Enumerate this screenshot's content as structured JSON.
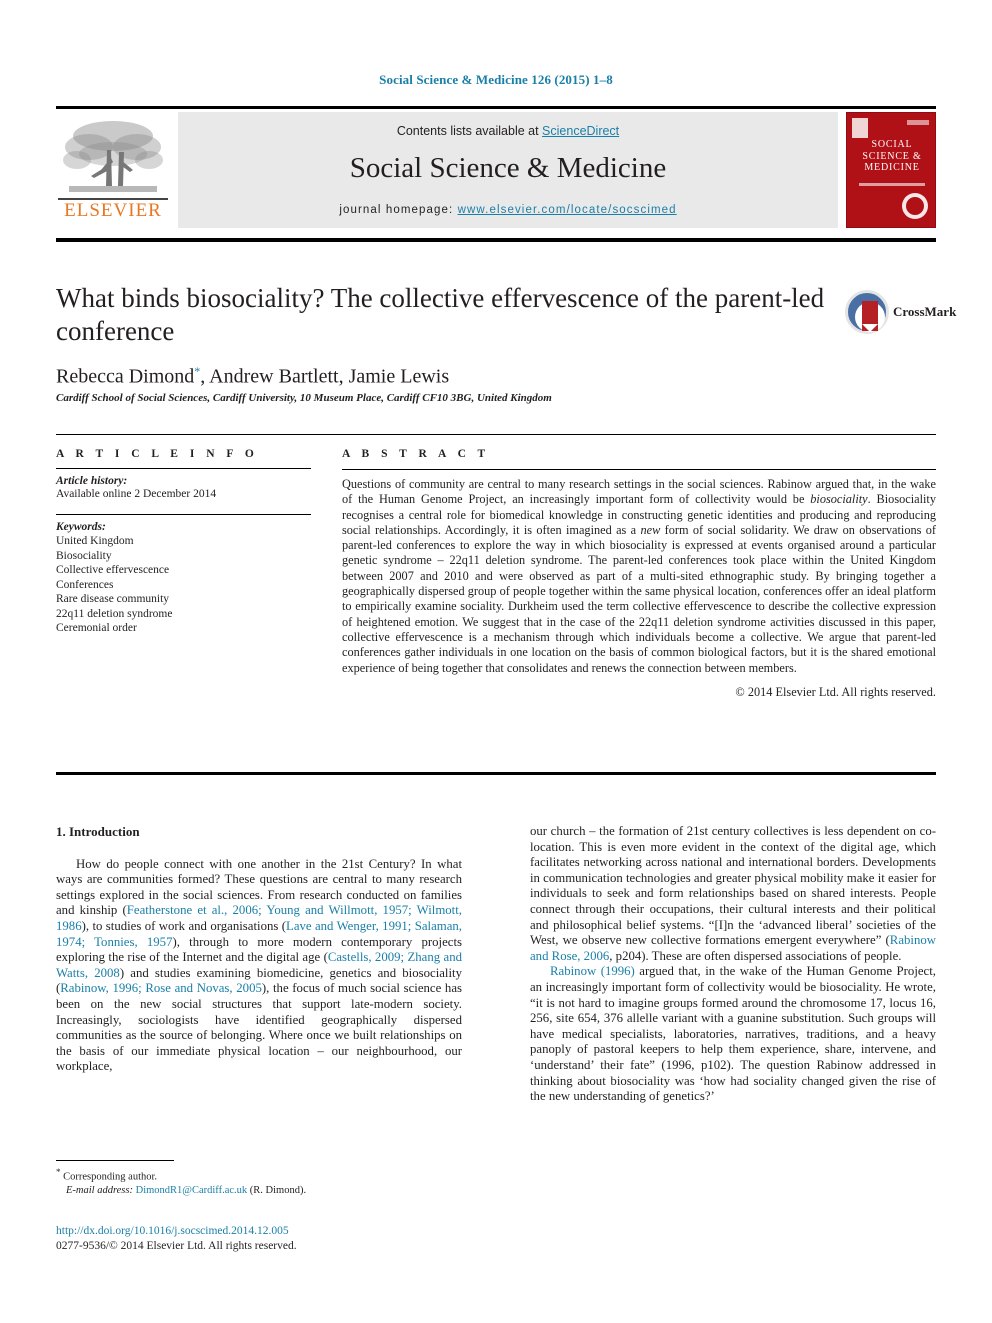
{
  "running_head": "Social Science & Medicine 126 (2015) 1–8",
  "masthead": {
    "contents_prefix": "Contents lists available at ",
    "sciencedirect": "ScienceDirect",
    "journal_name": "Social Science & Medicine",
    "homepage_prefix": "journal homepage: ",
    "homepage_url": "www.elsevier.com/locate/socscimed",
    "publisher_logo_text": "ELSEVIER",
    "cover_title": "SOCIAL SCIENCE & MEDICINE",
    "accent_link_color": "#1a7fa8",
    "publisher_orange": "#E87722",
    "cover_red": "#b01117"
  },
  "crossmark": {
    "label": "CrossMark",
    "badge_color": "#4a6fa5"
  },
  "article": {
    "title": "What binds biosociality? The collective effervescence of the parent-led conference",
    "authors": "Rebecca Dimond",
    "authors_rest": ", Andrew Bartlett, Jamie Lewis",
    "corresponding_marker": "*",
    "affiliation": "Cardiff School of Social Sciences, Cardiff University, 10 Museum Place, Cardiff CF10 3BG, United Kingdom"
  },
  "article_info": {
    "heading": "A R T I C L E   I N F O",
    "history_label": "Article history:",
    "history_value": "Available online 2 December 2014",
    "keywords_label": "Keywords:",
    "keywords": [
      "United Kingdom",
      "Biosociality",
      "Collective effervescence",
      "Conferences",
      "Rare disease community",
      "22q11 deletion syndrome",
      "Ceremonial order"
    ]
  },
  "abstract": {
    "heading": "A B S T R A C T",
    "part1": "Questions of community are central to many research settings in the social sciences. Rabinow argued that, in the wake of the Human Genome Project, an increasingly important form of collectivity would be ",
    "italic1": "biosociality",
    "part2": ". Biosociality recognises a central role for biomedical knowledge in constructing genetic identities and producing and reproducing social relationships. Accordingly, it is often imagined as a ",
    "italic2": "new",
    "part3": " form of social solidarity. We draw on observations of parent-led conferences to explore the way in which biosociality is expressed at events organised around a particular genetic syndrome – 22q11 deletion syndrome. The parent-led conferences took place within the United Kingdom between 2007 and 2010 and were observed as part of a multi-sited ethnographic study. By bringing together a geographically dispersed group of people together within the same physical location, conferences offer an ideal platform to empirically examine sociality. Durkheim used the term collective effervescence to describe the collective expression of heightened emotion. We suggest that in the case of the 22q11 deletion syndrome activities discussed in this paper, collective effervescence is a mechanism through which individuals become a collective. We argue that parent-led conferences gather individuals in one location on the basis of common biological factors, but it is the shared emotional experience of being together that consolidates and renews the connection between members.",
    "copyright": "© 2014 Elsevier Ltd. All rights reserved."
  },
  "body": {
    "section_number_title": "1. Introduction",
    "left_p1_a": "How do people connect with one another in the 21st Century? In what ways are communities formed? These questions are central to many research settings explored in the social sciences. From research conducted on families and kinship (",
    "left_ref1": "Featherstone et al., 2006; Young and Willmott, 1957; Wilmott, 1986",
    "left_p1_b": "), to studies of work and organisations (",
    "left_ref2": "Lave and Wenger, 1991; Salaman, 1974; Tonnies, 1957",
    "left_p1_c": "), through to more modern contemporary projects exploring the rise of the Internet and the digital age (",
    "left_ref3": "Castells, 2009; Zhang and Watts, 2008",
    "left_p1_d": ") and studies examining biomedicine, genetics and biosociality (",
    "left_ref4": "Rabinow, 1996; Rose and Novas, 2005",
    "left_p1_e": "), the focus of much social science has been on the new social structures that support late-modern society. Increasingly, sociologists have identified geographically dispersed communities as the source of belonging. Where once we built relationships on the basis of our immediate physical location – our neighbourhood, our workplace,",
    "right_p1_a": "our church – the formation of 21st century collectives is less dependent on co-location. This is even more evident in the context of the digital age, which facilitates networking across national and international borders. Developments in communication technologies and greater physical mobility make it easier for individuals to seek and form relationships based on shared interests. People connect through their occupations, their cultural interests and their political and philosophical belief systems. “[I]n the ‘advanced liberal’ societies of the West, we observe new collective formations emergent everywhere” (",
    "right_ref1": "Rabinow and Rose, 2006",
    "right_p1_b": ", p204). These are often dispersed associations of people.",
    "right_ref2": "Rabinow (1996)",
    "right_p2": " argued that, in the wake of the Human Genome Project, an increasingly important form of collectivity would be biosociality. He wrote, “it is not hard to imagine groups formed around the chromosome 17, locus 16, 256, site 654, 376 allelle variant with a guanine substitution. Such groups will have medical specialists, laboratories, narratives, traditions, and a heavy panoply of pastoral keepers to help them experience, share, intervene, and ‘understand’ their fate” (1996, p102). The question Rabinow addressed in thinking about biosociality was ‘how had sociality changed given the rise of the new understanding of genetics?’"
  },
  "footnote": {
    "star": "*",
    "corresponding": " Corresponding author.",
    "email_label": "E-mail address:",
    "email": "DimondR1@Cardiff.ac.uk",
    "email_owner": " (R. Dimond)."
  },
  "footer": {
    "doi": "http://dx.doi.org/10.1016/j.socscimed.2014.12.005",
    "issn_line": "0277-9536/© 2014 Elsevier Ltd. All rights reserved."
  }
}
